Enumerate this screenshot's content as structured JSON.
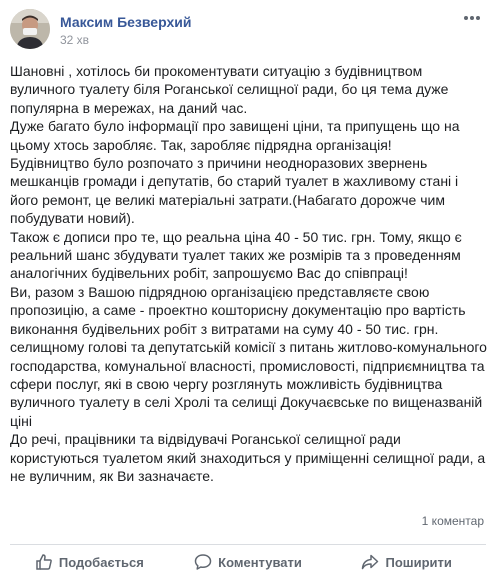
{
  "post": {
    "author": "Максим Безверхий",
    "timestamp": "32 хв",
    "body": [
      "Шановні , хотілось би прокоментувати ситуацію з будівництвом вуличного туалету біля Роганської селищної ради, бо ця тема дуже популярна в мережах, на даний час.",
      "Дуже багато було інформації про завищені ціни, та припущень що на цьому хтось заробляє. Так, заробляє підрядна організація!",
      "Будівництво було розпочато з причини неодноразових звернень мешканців громади і депутатів, бо старий туалет в жахливому стані і його ремонт, це великі матеріальні затрати.(Набагато дорожче чим побудувати новий).",
      "Також є дописи про те, що реальна ціна 40 - 50 тис. грн. Тому, якщо є реальний шанс збудувати туалет таких же розмірів та з проведенням аналогічних будівельних робіт, запрошуємо Вас до співпраці!",
      "Ви, разом з Вашою підрядною організацією представляєте свою пропозицію, а саме - проектно кошторисну документацію про вартість виконання будівельних робіт з витратами на суму 40 - 50 тис. грн. селищному голові та депутатській комісії з питань житлово-комунального господарства, комунальної власності, промисловості, підприємництва та сфери послуг, які в свою чергу розглянуть можливість будівництва вуличного туалету в селі Хролі та селищі Докучаєвське по вищеназваній ціні",
      "До речі, працівники та відвідувачі Роганської селищної ради користуються туалетом який знаходиться у приміщенні селищної ради, а не вуличним, як Ви зазначаєте."
    ],
    "comments_count": "1 коментар"
  },
  "actions": {
    "like": "Подобається",
    "comment": "Коментувати",
    "share": "Поширити"
  },
  "icons": {
    "more": "more-dots-icon",
    "like": "thumbs-up-icon",
    "comment": "speech-bubble-icon",
    "share": "share-arrow-icon"
  },
  "colors": {
    "author": "#385898",
    "text": "#1c1e21",
    "muted": "#606770",
    "divider": "#dadde1"
  }
}
